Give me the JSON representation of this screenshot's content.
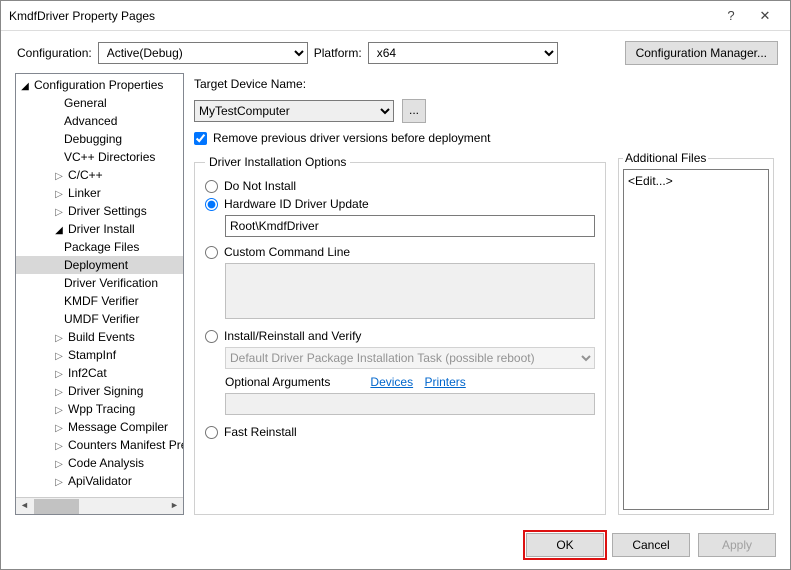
{
  "window": {
    "title": "KmdfDriver Property Pages"
  },
  "topbar": {
    "config_label": "Configuration:",
    "config_value": "Active(Debug)",
    "platform_label": "Platform:",
    "platform_value": "x64",
    "cfg_mgr": "Configuration Manager..."
  },
  "tree": {
    "root": "Configuration Properties",
    "items": [
      {
        "label": "General",
        "indent": 48
      },
      {
        "label": "Advanced",
        "indent": 48
      },
      {
        "label": "Debugging",
        "indent": 48
      },
      {
        "label": "VC++ Directories",
        "indent": 48
      },
      {
        "label": "C/C++",
        "indent": 34,
        "arrow": "closed"
      },
      {
        "label": "Linker",
        "indent": 34,
        "arrow": "closed"
      },
      {
        "label": "Driver Settings",
        "indent": 34,
        "arrow": "closed"
      },
      {
        "label": "Driver Install",
        "indent": 34,
        "arrow": "open"
      },
      {
        "label": "Package Files",
        "indent": 48
      },
      {
        "label": "Deployment",
        "indent": 48,
        "selected": true
      },
      {
        "label": "Driver Verification",
        "indent": 48
      },
      {
        "label": "KMDF Verifier",
        "indent": 48
      },
      {
        "label": "UMDF Verifier",
        "indent": 48
      },
      {
        "label": "Build Events",
        "indent": 34,
        "arrow": "closed"
      },
      {
        "label": "StampInf",
        "indent": 34,
        "arrow": "closed"
      },
      {
        "label": "Inf2Cat",
        "indent": 34,
        "arrow": "closed"
      },
      {
        "label": "Driver Signing",
        "indent": 34,
        "arrow": "closed"
      },
      {
        "label": "Wpp Tracing",
        "indent": 34,
        "arrow": "closed"
      },
      {
        "label": "Message Compiler",
        "indent": 34,
        "arrow": "closed"
      },
      {
        "label": "Counters Manifest Preprocessor",
        "indent": 34,
        "arrow": "closed"
      },
      {
        "label": "Code Analysis",
        "indent": 34,
        "arrow": "closed"
      },
      {
        "label": "ApiValidator",
        "indent": 34,
        "arrow": "closed"
      }
    ]
  },
  "form": {
    "target_label": "Target Device Name:",
    "target_value": "MyTestComputer",
    "browse": "...",
    "remove_prev": "Remove previous driver versions before deployment",
    "group_title": "Driver Installation Options",
    "opt_do_not_install": "Do Not Install",
    "opt_hw_id": "Hardware ID Driver Update",
    "hw_id_value": "Root\\KmdfDriver",
    "opt_custom": "Custom Command Line",
    "opt_install_verify": "Install/Reinstall and Verify",
    "task_value": "Default Driver Package Installation Task (possible reboot)",
    "optional_args": "Optional Arguments",
    "link_devices": "Devices",
    "link_printers": "Printers",
    "opt_fast": "Fast Reinstall"
  },
  "side": {
    "files_title": "Additional Files",
    "files_value": "<Edit...>"
  },
  "footer": {
    "ok": "OK",
    "cancel": "Cancel",
    "apply": "Apply"
  }
}
